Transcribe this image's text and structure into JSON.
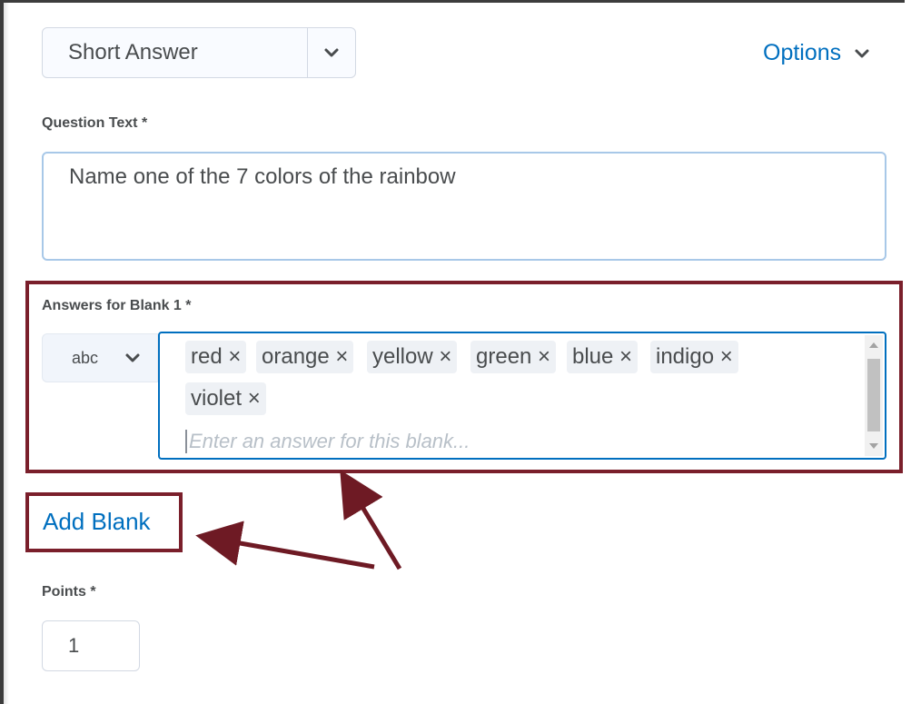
{
  "question_type": {
    "selected": "Short Answer"
  },
  "options_label": "Options",
  "question_text": {
    "label": "Question Text *",
    "value": "Name one of the 7 colors of the rainbow"
  },
  "answers": {
    "label": "Answers for Blank 1 *",
    "evaluation_type": "abc",
    "chips": [
      "red ×",
      "orange ×",
      "yellow ×",
      "green ×",
      "blue ×",
      "indigo ×",
      "violet ×"
    ],
    "placeholder": "Enter an answer for this blank..."
  },
  "add_blank_label": "Add Blank",
  "points": {
    "label": "Points *",
    "value": "1"
  },
  "colors": {
    "accent": "#006fbf",
    "highlight": "#7a1f2b",
    "text": "#494c4e"
  }
}
